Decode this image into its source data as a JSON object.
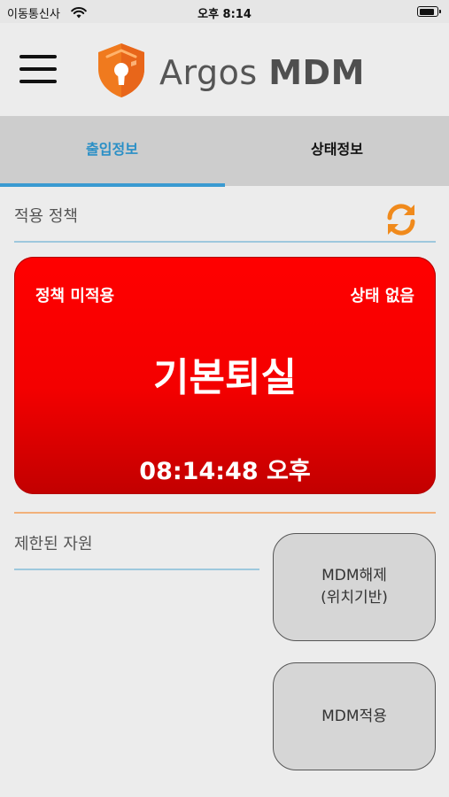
{
  "status_bar": {
    "carrier": "이동통신사",
    "time": "오후 8:14",
    "battery_level": 0.9
  },
  "header": {
    "brand_part1": "Argos",
    "brand_part2": "MDM",
    "menu_icon": "hamburger-menu-icon",
    "logo_icon": "shield-keyhole-logo"
  },
  "tabs": [
    {
      "label": "출입정보",
      "active": true
    },
    {
      "label": "상태정보",
      "active": false
    }
  ],
  "applied_policy": {
    "title": "적용 정책",
    "refresh_icon": "refresh-icon",
    "card": {
      "policy_status": "정책 미적용",
      "state": "상태 없음",
      "name": "기본퇴실",
      "time": "08:14:48 오후"
    }
  },
  "restricted": {
    "title": "제한된 자원"
  },
  "buttons": {
    "release_line1": "MDM해제",
    "release_line2": "(위치기반)",
    "apply": "MDM적용"
  },
  "colors": {
    "accent_blue": "#2a8fc6",
    "card_red": "#ff0000",
    "refresh_orange": "#f08a1c"
  }
}
